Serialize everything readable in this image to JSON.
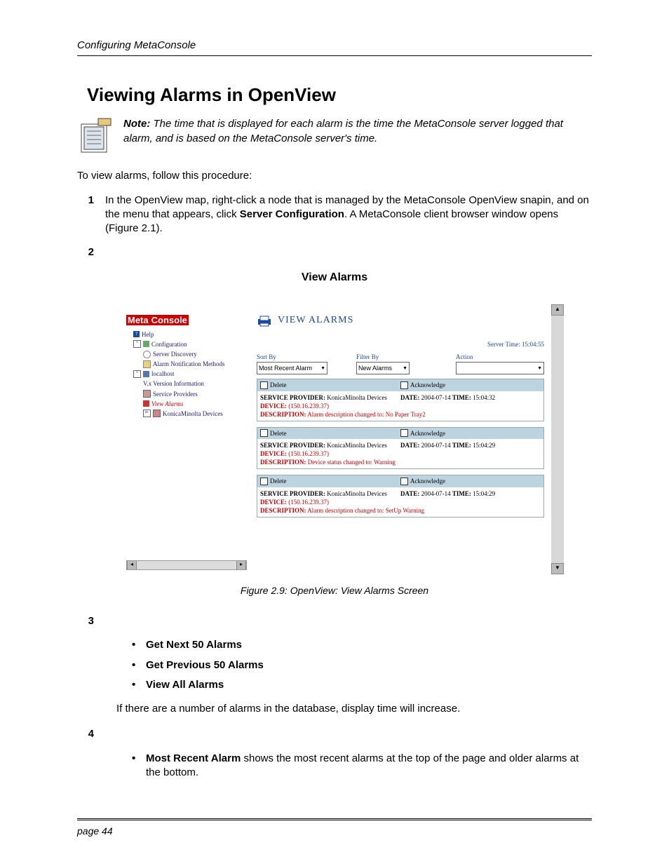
{
  "header": {
    "running": "Configuring MetaConsole"
  },
  "section": {
    "title": "Viewing Alarms in OpenView"
  },
  "note": {
    "label": "Note:",
    "text": "The time that is displayed for each alarm is the time the MetaConsole server logged that alarm, and is based on the MetaConsole server's time."
  },
  "intro": "To view alarms, follow this procedure:",
  "step1": {
    "num": "1",
    "pre": "In the OpenView map, right-click a node that is managed by the MetaConsole OpenView snapin, and on the menu that appears, click ",
    "bold": "Server Configuration",
    "post": ". A MetaConsole client browser window opens (Figure 2.1)."
  },
  "step2": {
    "num": "2",
    "subhead": "View Alarms"
  },
  "figure": {
    "caption": "Figure 2.9:  OpenView: View Alarms Screen"
  },
  "step3": {
    "num": "3",
    "items": [
      "Get Next 50 Alarms",
      "Get Previous 50 Alarms",
      "View All Alarms"
    ],
    "after": "If there are a number of alarms in the database, display time will increase."
  },
  "step4": {
    "num": "4",
    "bullet_bold": "Most Recent Alarm",
    "bullet_rest": " shows the most recent alarms at the top of the page and older alarms at the bottom."
  },
  "footer": {
    "page": "page 44"
  },
  "screenshot": {
    "logo": {
      "meta": "Meta",
      "console": "Console"
    },
    "tree": {
      "help": "Help",
      "configuration": "Configuration",
      "server_discovery": "Server Discovery",
      "alarm_notif": "Alarm Notification Methods",
      "localhost": "localhost",
      "version_info": "V.x Version Information",
      "service_providers": "Service Providers",
      "view_alarms": "View Alarms",
      "km_devices": "KonicaMinolta Devices"
    },
    "title": "VIEW ALARMS",
    "server_time": "Server Time: 15:04:55",
    "controls": {
      "sort_label": "Sort By",
      "sort_value": "Most Recent Alarm",
      "filter_label": "Filter By",
      "filter_value": "New Alarms",
      "action_label": "Action",
      "action_value": ""
    },
    "alarms": [
      {
        "delete": "Delete",
        "ack": "Acknowledge",
        "sp_label": "SERVICE PROVIDER:",
        "sp_value": "KonicaMinolta Devices",
        "date_label": "DATE:",
        "date_value": "2004-07-14",
        "time_label": "TIME:",
        "time_value": "15:04:32",
        "device_label": "DEVICE:",
        "device_value": "(150.16.239.37)",
        "desc_label": "DESCRIPTION:",
        "desc_value": "Alarm description changed to: No Paper Tray2"
      },
      {
        "delete": "Delete",
        "ack": "Acknowledge",
        "sp_label": "SERVICE PROVIDER:",
        "sp_value": "KonicaMinolta Devices",
        "date_label": "DATE:",
        "date_value": "2004-07-14",
        "time_label": "TIME:",
        "time_value": "15:04:29",
        "device_label": "DEVICE:",
        "device_value": "(150.16.239.37)",
        "desc_label": "DESCRIPTION:",
        "desc_value": "Device status changed to: Warning"
      },
      {
        "delete": "Delete",
        "ack": "Acknowledge",
        "sp_label": "SERVICE PROVIDER:",
        "sp_value": "KonicaMinolta Devices",
        "date_label": "DATE:",
        "date_value": "2004-07-14",
        "time_label": "TIME:",
        "time_value": "15:04:29",
        "device_label": "DEVICE:",
        "device_value": "(150.16.239.37)",
        "desc_label": "DESCRIPTION:",
        "desc_value": "Alarm description changed to: SetUp Warning"
      }
    ]
  }
}
